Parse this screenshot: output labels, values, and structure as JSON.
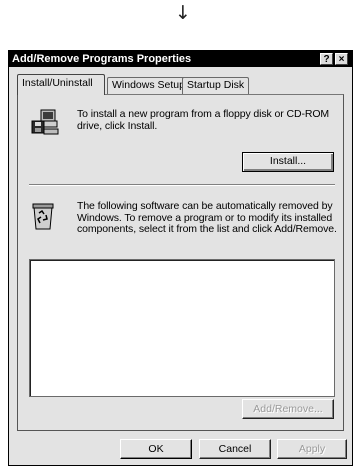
{
  "decor": {
    "arrow": "↓"
  },
  "window": {
    "title": "Add/Remove Programs Properties",
    "help_label": "?",
    "close_label": "×"
  },
  "tabs": [
    {
      "label": "Install/Uninstall",
      "active": true
    },
    {
      "label": "Windows Setup",
      "active": false
    },
    {
      "label": "Startup Disk",
      "active": false
    }
  ],
  "install_section": {
    "icon": "floppy-computer-icon",
    "description": "To install a new program from a floppy disk or CD-ROM drive, click Install.",
    "button_label": "Install..."
  },
  "uninstall_section": {
    "icon": "recycle-bin-icon",
    "description": "The following software can be automatically removed by Windows. To remove a program or to modify its installed components, select it from the list and click Add/Remove.",
    "list_items": [],
    "button_label": "Add/Remove..."
  },
  "footer": {
    "ok_label": "OK",
    "cancel_label": "Cancel",
    "apply_label": "Apply"
  }
}
